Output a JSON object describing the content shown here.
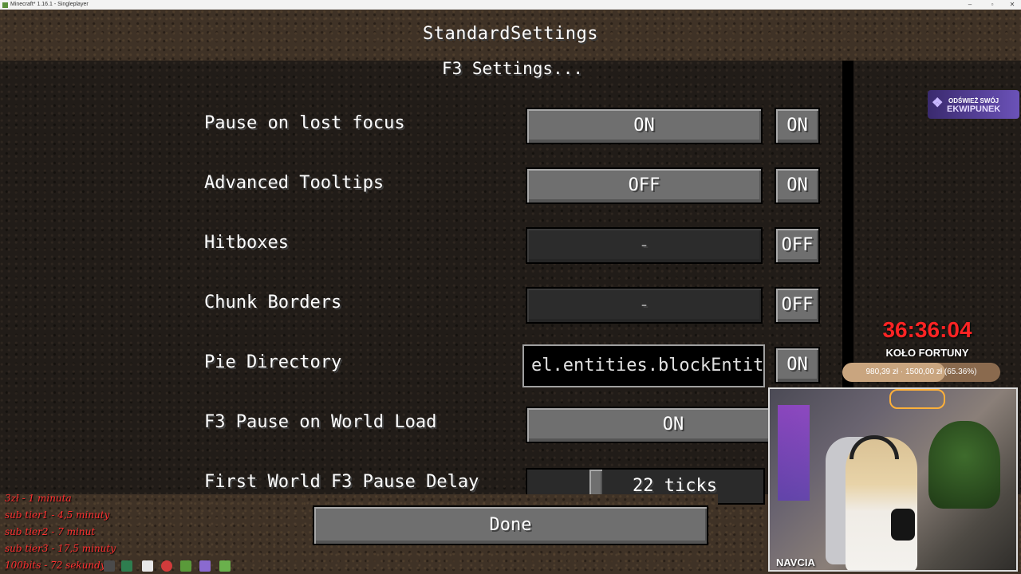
{
  "window": {
    "title": "Minecraft* 1.16.1 - Singleplayer",
    "controls": [
      "–",
      "▫",
      "✕"
    ]
  },
  "screen": {
    "title": "StandardSettings",
    "subheader": "F3 Settings..."
  },
  "options": [
    {
      "label": "Pause on lost focus",
      "value": "ON",
      "toggle": "ON",
      "disabled": false
    },
    {
      "label": "Advanced Tooltips",
      "value": "OFF",
      "toggle": "ON",
      "disabled": false
    },
    {
      "label": "Hitboxes",
      "value": "-",
      "toggle": "OFF",
      "disabled": true
    },
    {
      "label": "Chunk Borders",
      "value": "-",
      "toggle": "OFF",
      "disabled": true
    },
    {
      "label": "Pie Directory",
      "value": "el.entities.blockEntities",
      "toggle": "ON"
    },
    {
      "label": "F3 Pause on World Load",
      "value": "ON"
    },
    {
      "label": "First World F3 Pause Delay",
      "value": "22 ticks"
    }
  ],
  "done_label": "Done",
  "overlay": {
    "badge_line1": "ODŚWIEŻ SWÓJ",
    "badge_line2": "EKWIPUNEK",
    "timer": "36:36:04",
    "wheel_title": "KOŁO FORTUNY",
    "progress_text": "980,39 zł · 1500,00 zł (65.36%)",
    "progress_fraction": 0.6536,
    "webcam_name": "NAVCIA"
  },
  "tips": [
    "3zł - 1 minuta",
    "sub tier1 - 4,5 minuty",
    "sub tier2 - 7 minut",
    "sub tier3 - 17,5 minuty",
    "100bits - 72 sekundy"
  ]
}
